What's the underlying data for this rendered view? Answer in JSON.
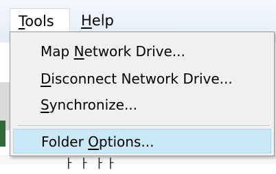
{
  "menubar": {
    "items": [
      {
        "label_first": "T",
        "label_rest": "ools"
      },
      {
        "label_first": "H",
        "label_rest": "elp"
      }
    ]
  },
  "dropdown": {
    "items": [
      {
        "before": "Map ",
        "mnemonic": "N",
        "after": "etwork Drive..."
      },
      {
        "before": "",
        "mnemonic": "D",
        "after": "isconnect Network Drive..."
      },
      {
        "before": "",
        "mnemonic": "S",
        "after": "ynchronize..."
      },
      {
        "before": "Folder ",
        "mnemonic": "O",
        "after": "ptions...",
        "highlighted": true
      }
    ]
  },
  "background": {
    "partial_text": "ㅏ   ㅏ ㅏㅏ"
  }
}
